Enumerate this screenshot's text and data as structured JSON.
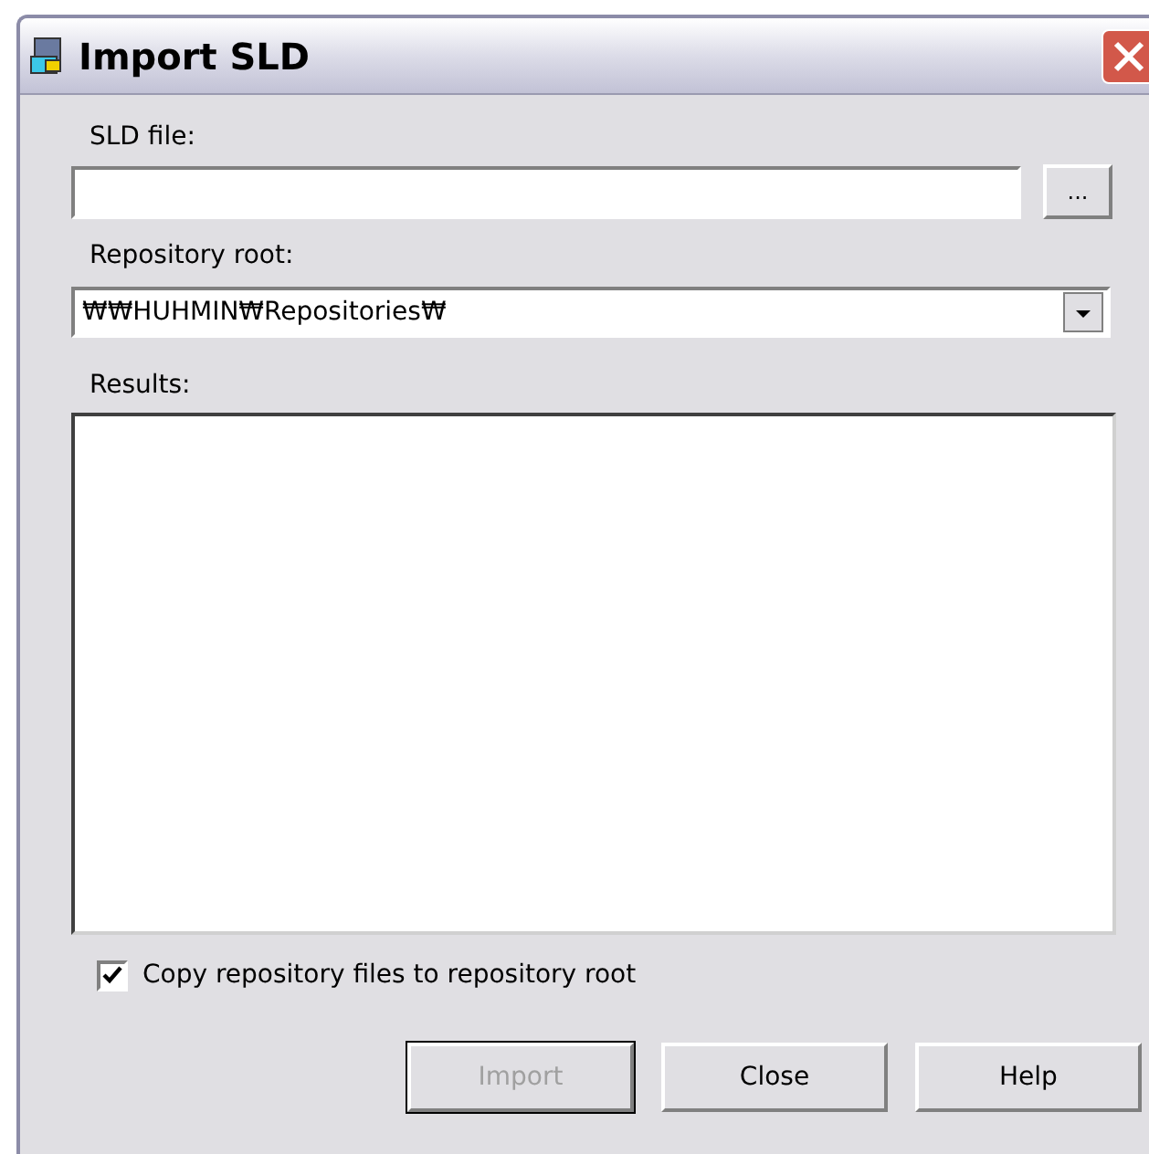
{
  "window": {
    "title": "Import SLD"
  },
  "sld_file": {
    "label": "SLD file:",
    "browse_label": "..."
  },
  "repository_root": {
    "label": "Repository root:",
    "value": "₩₩HUHMIN₩Repositories₩"
  },
  "results": {
    "label": "Results:"
  },
  "copy_option": {
    "label": "Copy repository files to repository root",
    "checked": true
  },
  "buttons": [
    {
      "label": "Import",
      "disabled": true,
      "default": true
    },
    {
      "label": "Close",
      "disabled": false,
      "default": false
    },
    {
      "label": "Help",
      "disabled": false,
      "default": false
    }
  ]
}
